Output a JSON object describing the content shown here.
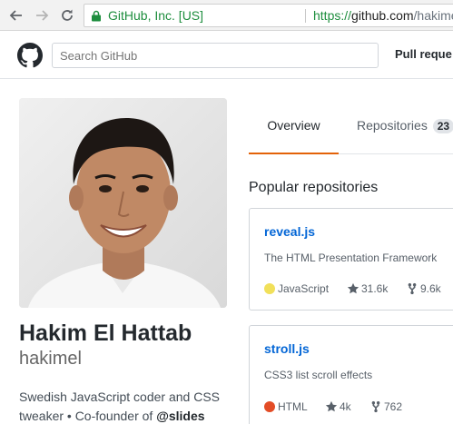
{
  "browser": {
    "secure_label": "GitHub, Inc. [US]",
    "url_scheme": "https://",
    "url_host": "github.com",
    "url_path": "/hakimel"
  },
  "header": {
    "search_placeholder": "Search GitHub",
    "pull_requests_label": "Pull reque"
  },
  "profile": {
    "full_name": "Hakim El Hattab",
    "username": "hakimel",
    "bio_text": "Swedish JavaScript coder and CSS tweaker • Co-founder of ",
    "bio_mention": "@slides"
  },
  "tabs": {
    "overview": "Overview",
    "repositories": "Repositories",
    "repositories_count": "23"
  },
  "popular": {
    "title": "Popular repositories",
    "repos": [
      {
        "name": "reveal.js",
        "description": "The HTML Presentation Framework",
        "language": "JavaScript",
        "language_color": "#f1e05a",
        "stars": "31.6k",
        "forks": "9.6k"
      },
      {
        "name": "stroll.js",
        "description": "CSS3 list scroll effects",
        "language": "HTML",
        "language_color": "#e34c26",
        "stars": "4k",
        "forks": "762"
      }
    ]
  }
}
